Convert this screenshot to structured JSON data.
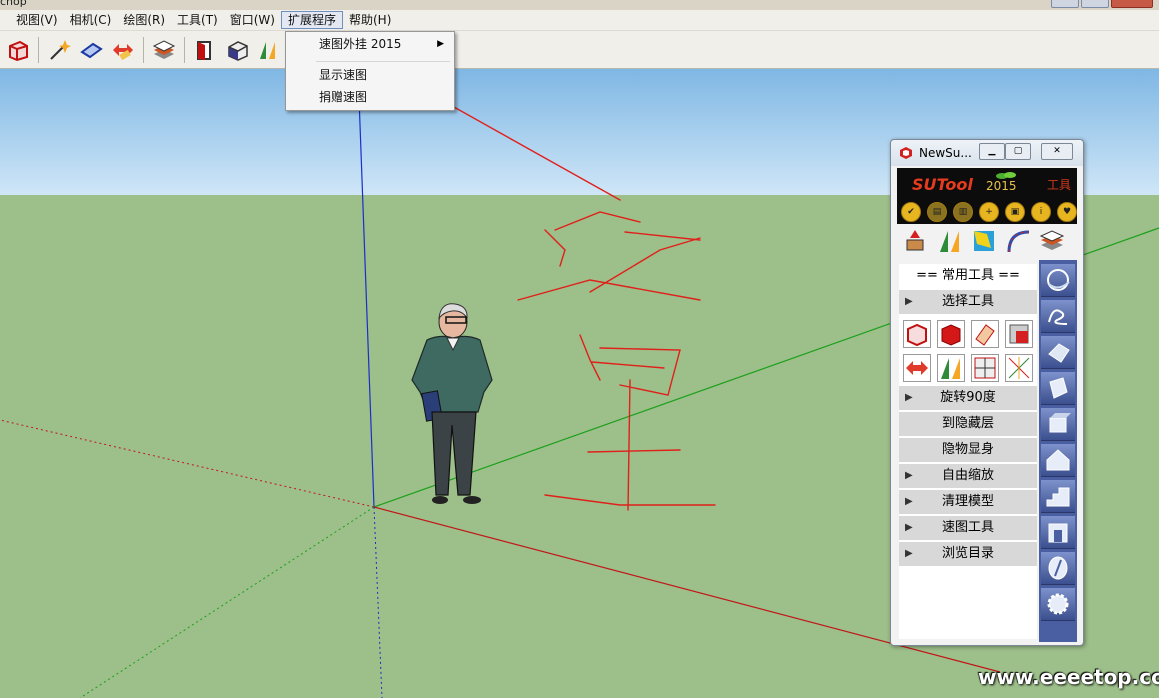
{
  "window": {
    "title_fragment": "chop"
  },
  "menubar": {
    "items": [
      {
        "label": "视图(V)"
      },
      {
        "label": "相机(C)"
      },
      {
        "label": "绘图(R)"
      },
      {
        "label": "工具(T)"
      },
      {
        "label": "窗口(W)"
      },
      {
        "label": "扩展程序"
      },
      {
        "label": "帮助(H)"
      }
    ],
    "active": "扩展程序"
  },
  "dropdown": {
    "items": [
      {
        "label": "速图外挂 2015",
        "has_submenu": true
      },
      {
        "label": "显示速图"
      },
      {
        "label": "捐赠速图"
      }
    ]
  },
  "panel": {
    "title": "NewSu...",
    "banner": {
      "logo": "SUTool",
      "year": "2015",
      "tool_label": "工具"
    },
    "section_header": "== 常用工具 ==",
    "sections": [
      {
        "label": "选择工具",
        "expandable": true
      },
      {
        "label": "旋转90度",
        "expandable": true
      },
      {
        "label": "到隐藏层",
        "expandable": false
      },
      {
        "label": "隐物显身",
        "expandable": false
      },
      {
        "label": "自由缩放",
        "expandable": true
      },
      {
        "label": "清理模型",
        "expandable": true
      },
      {
        "label": "速图工具",
        "expandable": true
      },
      {
        "label": "浏览目录",
        "expandable": true
      }
    ]
  },
  "watermark": "www.eeeetop.com",
  "colors": {
    "sky_top": "#7fb7e4",
    "ground": "#9dbf8a",
    "annotation_red": "#e0201a",
    "axis_red": "#c0181a",
    "axis_green": "#1aa01a",
    "axis_blue": "#1c2ec8"
  }
}
